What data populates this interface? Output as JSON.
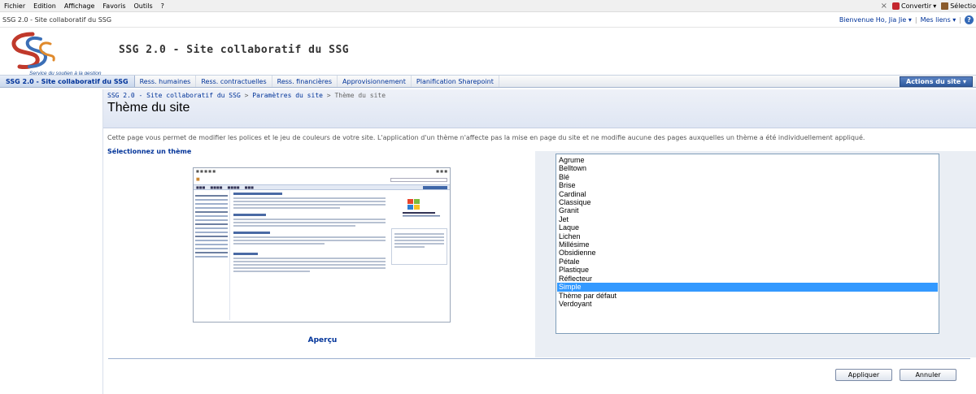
{
  "browser": {
    "menu": [
      "Fichier",
      "Edition",
      "Affichage",
      "Favoris",
      "Outils",
      "?"
    ],
    "close_glyph": "×",
    "convertir_label": "Convertir",
    "selection_label": "Sélectio"
  },
  "topbar": {
    "site_crumb": "SSG 2.0 - Site collaboratif du SSG",
    "welcome": "Bienvenue Ho, Jia Jie ▾",
    "separator": "|",
    "mes_liens": "Mes liens ▾",
    "help_glyph": "?"
  },
  "header": {
    "logo_tagline": "Service du soutien à la gestion",
    "site_title": "SSG 2.0 - Site collaboratif du SSG"
  },
  "nav": {
    "home": "SSG 2.0 - Site collaboratif du SSG",
    "items": [
      "Ress. humaines",
      "Ress. contractuelles",
      "Ress. financières",
      "Approvisionnement",
      "Planification Sharepoint"
    ],
    "actions": "Actions du site ▾"
  },
  "page": {
    "breadcrumb": {
      "site": "SSG 2.0 - Site collaboratif du SSG",
      "sep": ">",
      "params": "Paramètres du site",
      "current": "Thème du site"
    },
    "title": "Thème du site",
    "description": "Cette page vous permet de modifier les polices et le jeu de couleurs de votre site. L'application d'un thème n'affecte pas la mise en page du site et ne modifie aucune des pages auxquelles un thème a été individuellement appliqué.",
    "select_label": "Sélectionnez un thème",
    "preview_label": "Aperçu",
    "themes": [
      "Agrume",
      "Belltown",
      "Blé",
      "Brise",
      "Cardinal",
      "Classique",
      "Granit",
      "Jet",
      "Laque",
      "Lichen",
      "Millésime",
      "Obsidienne",
      "Pétale",
      "Plastique",
      "Réflecteur",
      "Simple",
      "Thème par défaut",
      "Verdoyant"
    ],
    "selected_theme": "Simple",
    "apply_label": "Appliquer",
    "cancel_label": "Annuler"
  },
  "colors": {
    "link_blue": "#003399",
    "selection_blue": "#3399ff",
    "actions_blue": "#2f5b9f"
  }
}
